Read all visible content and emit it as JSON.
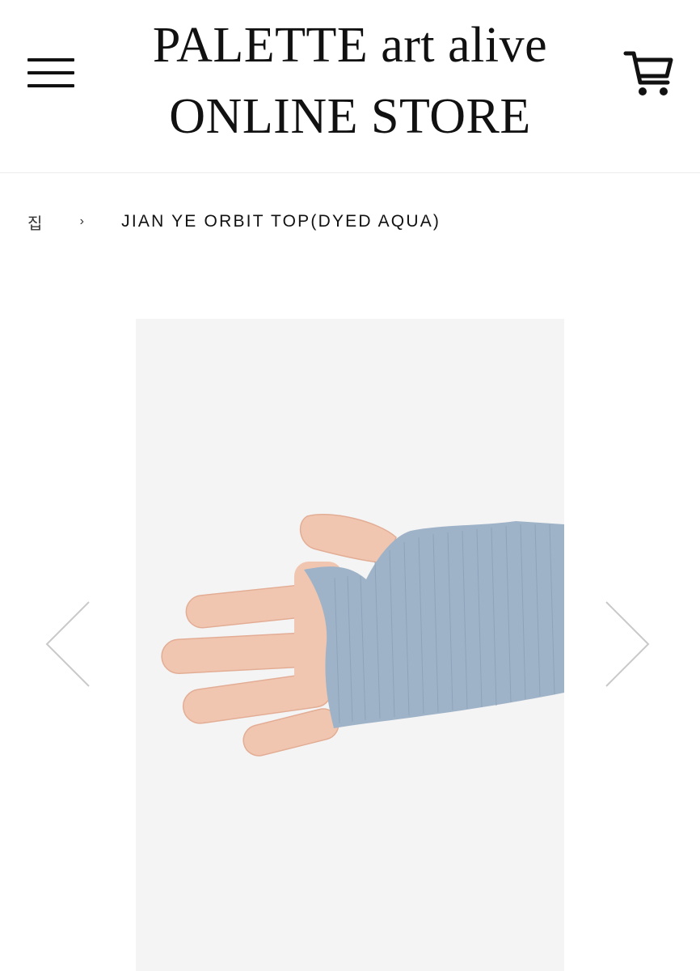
{
  "header": {
    "logo_line1": "PALETTE art alive",
    "logo_line2": "ONLINE STORE",
    "menu_icon": "hamburger-icon",
    "cart_icon": "cart-icon"
  },
  "breadcrumb": {
    "home_label": "집",
    "separator": "›",
    "current": "JIAN YE ORBIT TOP(DYED AQUA)"
  },
  "gallery": {
    "prev_icon": "chevron-left-icon",
    "next_icon": "chevron-right-icon",
    "product_image": "hand-in-aqua-ribbed-sleeve-image"
  },
  "colors": {
    "text": "#111111",
    "gallery_bg": "#f4f4f4",
    "sleeve": "#9fb3c8",
    "arrow": "#c9c9c9"
  }
}
